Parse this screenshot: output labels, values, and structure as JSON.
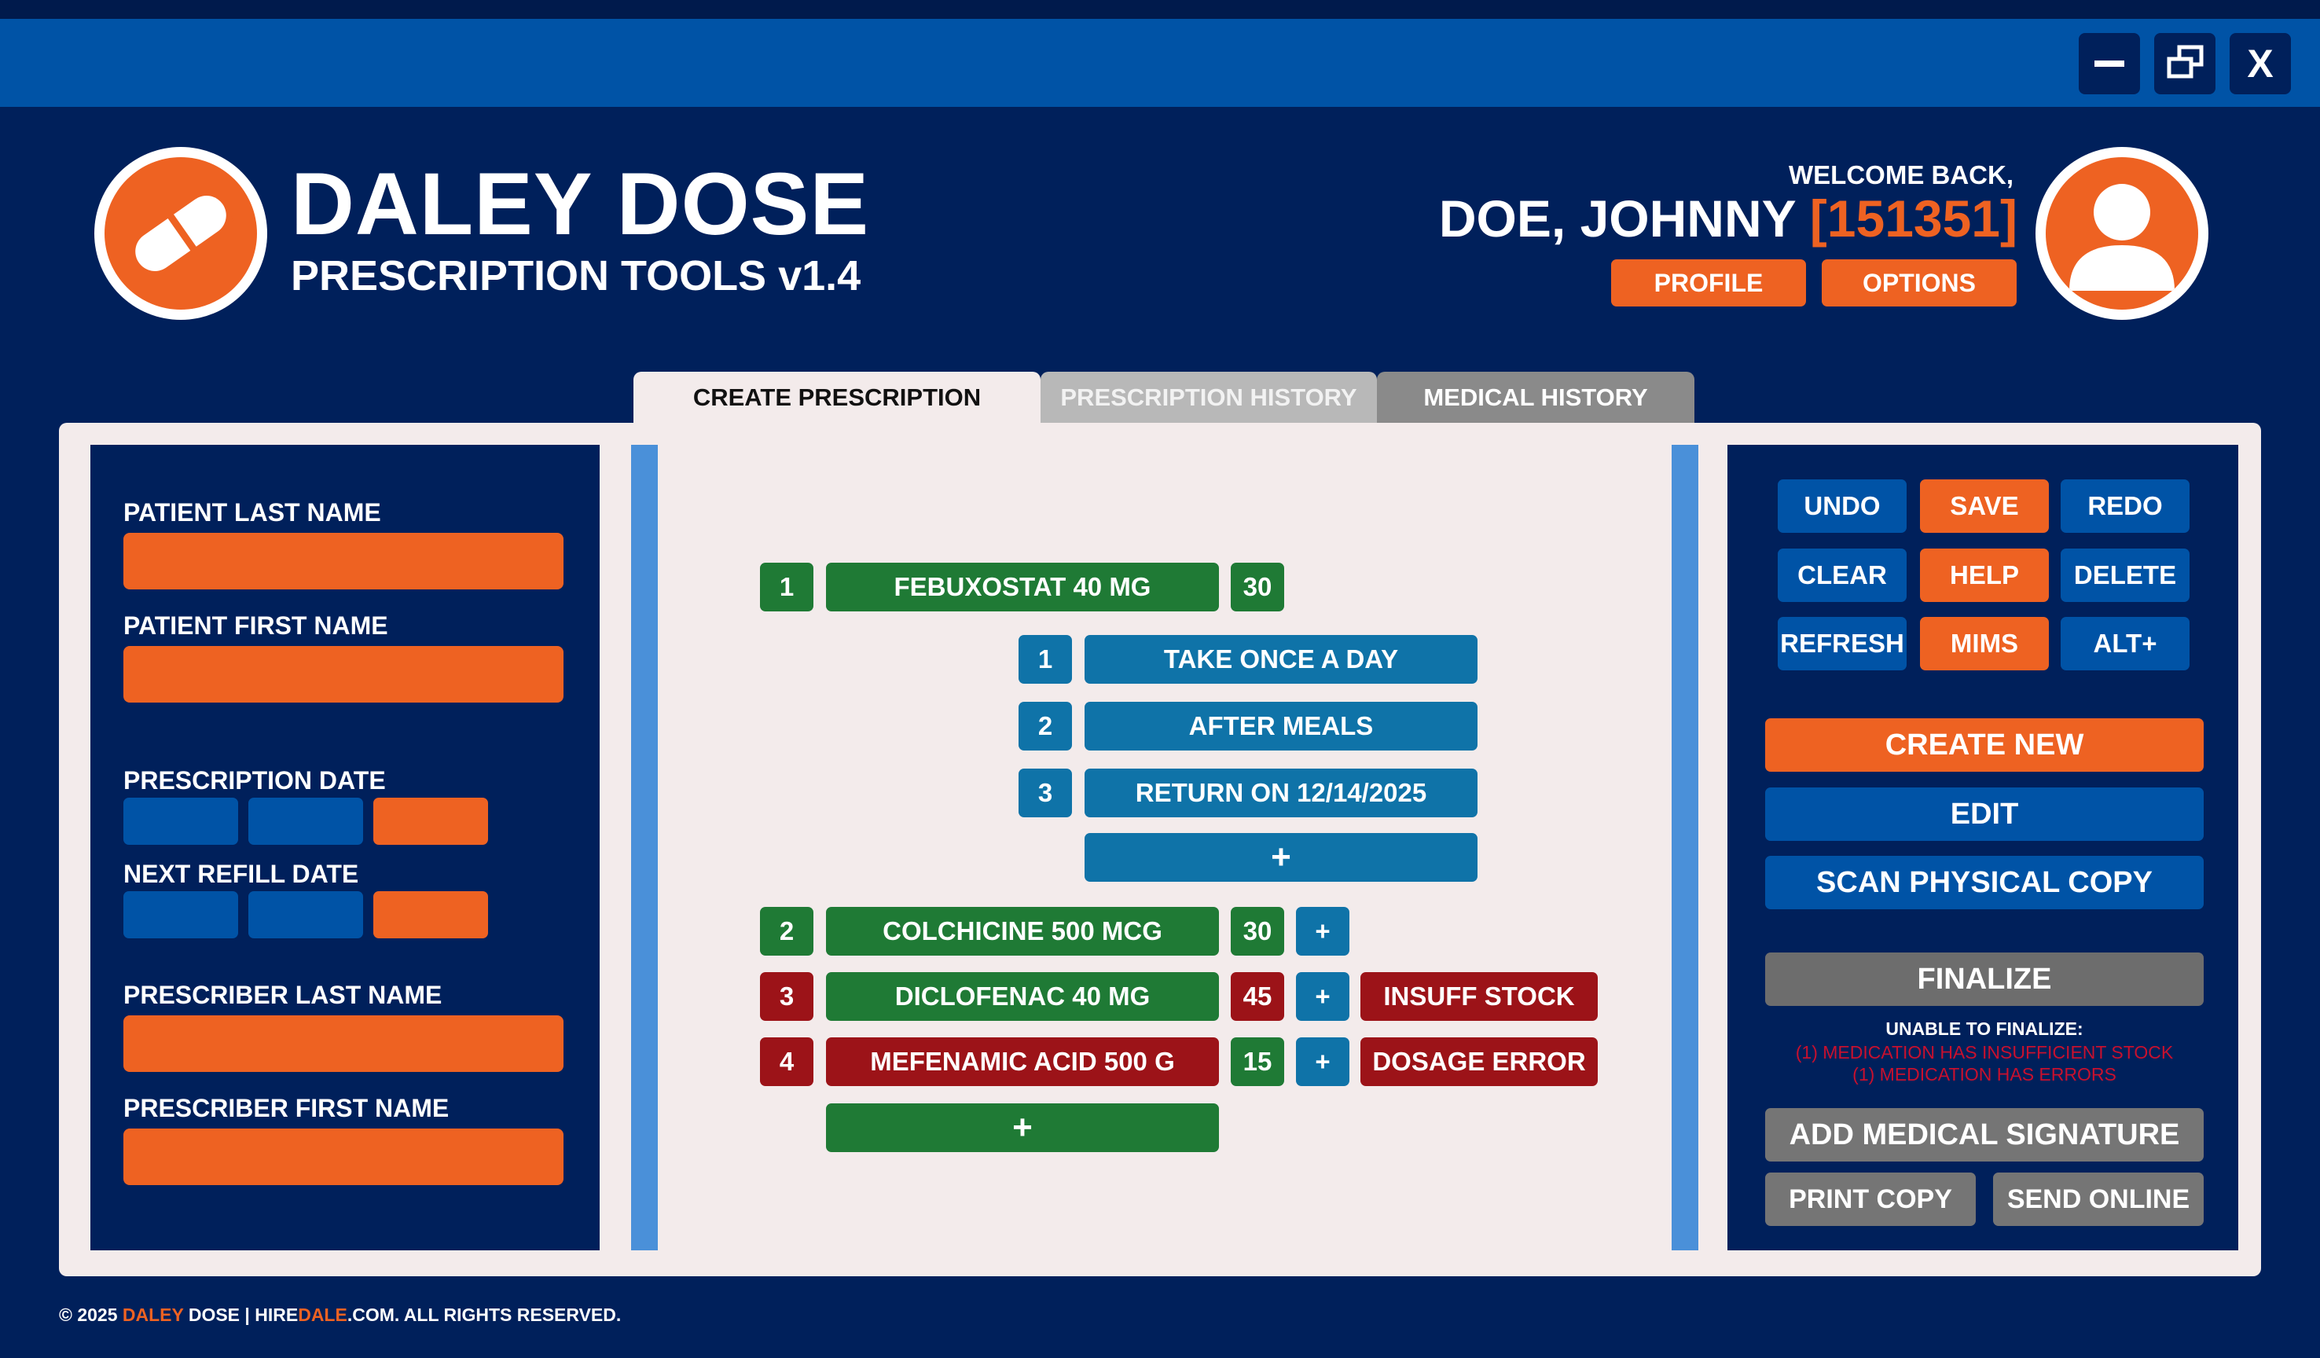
{
  "window": {
    "controls": [
      "minimize",
      "restore",
      "close"
    ],
    "close_label": "X"
  },
  "header": {
    "app_title": "DALEY DOSE",
    "app_subtitle": "PRESCRIPTION TOOLS v1.4",
    "welcome": "WELCOME BACK,",
    "user_name": "DOE, JOHNNY",
    "user_id": "[151351]",
    "profile_label": "PROFILE",
    "options_label": "OPTIONS"
  },
  "tabs": [
    {
      "label": "CREATE PRESCRIPTION",
      "active": true
    },
    {
      "label": "PRESCRIPTION HISTORY",
      "active": false
    },
    {
      "label": "MEDICAL HISTORY",
      "active": false
    }
  ],
  "form": {
    "patient_last_name": "PATIENT LAST NAME",
    "patient_first_name": "PATIENT FIRST NAME",
    "prescription_date": "PRESCRIPTION DATE",
    "next_refill_date": "NEXT REFILL DATE",
    "prescriber_last_name": "PRESCRIBER LAST NAME",
    "prescriber_first_name": "PRESCRIBER FIRST NAME"
  },
  "prescriptions": [
    {
      "num": "1",
      "name": "FEBUXOSTAT 40 MG",
      "qty": "30",
      "status": "ok",
      "instructions": [
        {
          "num": "1",
          "text": "TAKE ONCE A DAY"
        },
        {
          "num": "2",
          "text": "AFTER MEALS"
        },
        {
          "num": "3",
          "text": "RETURN ON 12/14/2025"
        }
      ],
      "add_instruction_label": "+"
    },
    {
      "num": "2",
      "name": "COLCHICINE 500 MCG",
      "qty": "30",
      "add_label": "+",
      "status": "ok",
      "flag": ""
    },
    {
      "num": "3",
      "name": "DICLOFENAC 40 MG",
      "qty": "45",
      "add_label": "+",
      "status": "error",
      "flag": "INSUFF STOCK"
    },
    {
      "num": "4",
      "name": "MEFENAMIC ACID 500 G",
      "qty": "15",
      "add_label": "+",
      "status": "error",
      "flag": "DOSAGE ERROR"
    }
  ],
  "add_medication_label": "+",
  "actions": {
    "undo": "UNDO",
    "save": "SAVE",
    "redo": "REDO",
    "clear": "CLEAR",
    "help": "HELP",
    "delete": "DELETE",
    "refresh": "REFRESH",
    "mims": "MIMS",
    "alt": "ALT+",
    "create_new": "CREATE NEW",
    "edit": "EDIT",
    "scan": "SCAN PHYSICAL COPY",
    "finalize": "FINALIZE",
    "finalize_error_title": "UNABLE TO FINALIZE:",
    "finalize_errors": [
      "(1) MEDICATION HAS INSUFFICIENT STOCK",
      "(1) MEDICATION HAS ERRORS"
    ],
    "add_signature": "ADD MEDICAL SIGNATURE",
    "print_copy": "PRINT COPY",
    "send_online": "SEND ONLINE"
  },
  "footer": {
    "copyright": "© 2025 ",
    "brand_a": "DALEY",
    "brand_b": " DOSE | HIRE",
    "brand_c": "DALE",
    "brand_d": ".COM. ALL RIGHTS RESERVED."
  },
  "colors": {
    "navy": "#00205b",
    "title_bar": "#0053a6",
    "orange": "#ee6222",
    "green": "#1f7a35",
    "teal": "#0f73a8",
    "red": "#9c1318",
    "panel_bg": "#f3ebeb"
  }
}
